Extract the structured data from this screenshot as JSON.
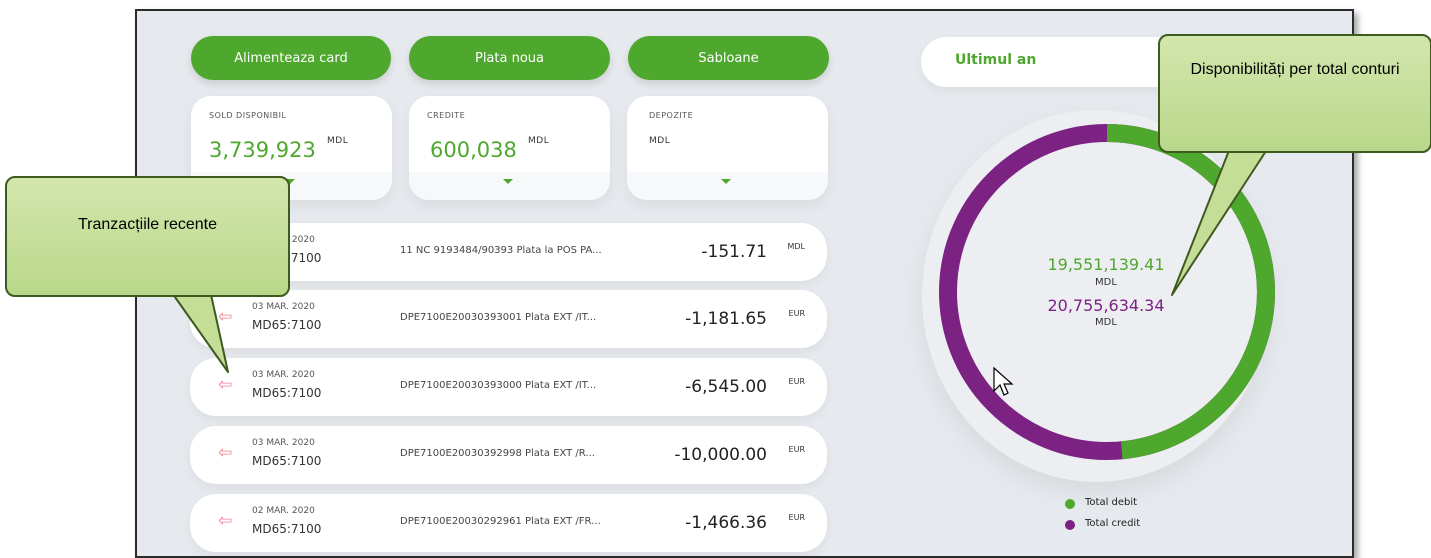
{
  "actions": {
    "top_up_label": "Alimenteaza card",
    "new_payment_label": "Plata noua",
    "templates_label": "Sabloane"
  },
  "summary": {
    "available": {
      "label": "SOLD DISPONIBIL",
      "value": "3,739,923",
      "currency": "MDL"
    },
    "credits": {
      "label": "CREDITE",
      "value": "600,038",
      "currency": "MDL"
    },
    "deposits": {
      "label": "DEPOZITE",
      "value": "",
      "currency": "MDL"
    }
  },
  "transactions": [
    {
      "date": "06 MAR. 2020",
      "account": "MD93:7100",
      "description": "11 NC 9193484/90393 Plata la POS PA...",
      "amount": "-151.71",
      "currency": "MDL"
    },
    {
      "date": "03 MAR. 2020",
      "account": "MD65:7100",
      "description": "DPE7100E20030393001 Plata EXT /IT...",
      "amount": "-1,181.65",
      "currency": "EUR"
    },
    {
      "date": "03 MAR. 2020",
      "account": "MD65:7100",
      "description": "DPE7100E20030393000 Plata EXT /IT...",
      "amount": "-6,545.00",
      "currency": "EUR"
    },
    {
      "date": "03 MAR. 2020",
      "account": "MD65:7100",
      "description": "DPE7100E20030392998 Plata EXT /R...",
      "amount": "-10,000.00",
      "currency": "EUR"
    },
    {
      "date": "02 MAR. 2020",
      "account": "MD65:7100",
      "description": "DPE7100E20030292961 Plata EXT /FR...",
      "amount": "-1,466.36",
      "currency": "EUR"
    }
  ],
  "chart": {
    "period_label": "Ultimul an",
    "debit_value": "19,551,139.41",
    "debit_currency": "MDL",
    "credit_value": "20,755,634.34",
    "credit_currency": "MDL",
    "legend_debit": "Total debit",
    "legend_credit": "Total credit",
    "debit_color": "#4ea82d",
    "credit_color": "#7b2283",
    "debit_share": 0.485
  },
  "callouts": {
    "transactions": "Tranzacțiile recente",
    "availability": "Disponibilități per total conturi"
  },
  "icons": {
    "transaction_arrow": "left-arrow-icon",
    "card_expand": "chevron-down-icon",
    "cursor": "mouse-cursor-icon"
  }
}
